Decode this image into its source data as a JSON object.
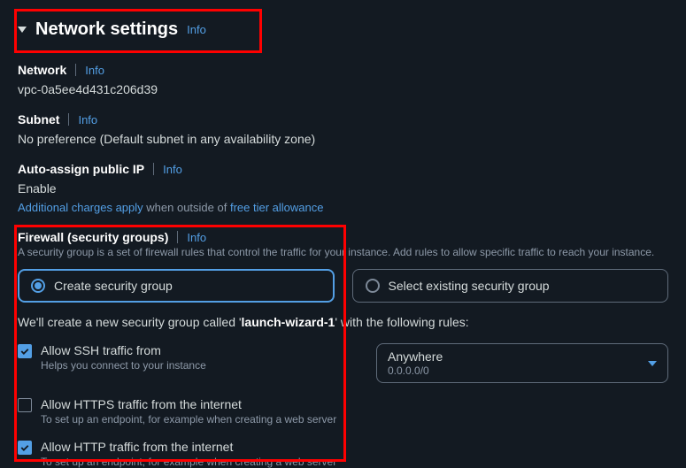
{
  "header": {
    "title": "Network settings",
    "info": "Info"
  },
  "network": {
    "label": "Network",
    "info": "Info",
    "value": "vpc-0a5ee4d431c206d39"
  },
  "subnet": {
    "label": "Subnet",
    "info": "Info",
    "value": "No preference (Default subnet in any availability zone)"
  },
  "publicIp": {
    "label": "Auto-assign public IP",
    "info": "Info",
    "value": "Enable",
    "charges_prefix": "Additional charges apply",
    "charges_mid": " when outside of ",
    "charges_link": "free tier allowance"
  },
  "firewall": {
    "label": "Firewall (security groups)",
    "info": "Info",
    "desc": "A security group is a set of firewall rules that control the traffic for your instance. Add rules to allow specific traffic to reach your instance.",
    "option_create": "Create security group",
    "option_select": "Select existing security group",
    "sg_note_pre": "We'll create a new security group called '",
    "sg_name": "launch-wizard-1",
    "sg_note_post": "' with the following rules:"
  },
  "rules": {
    "ssh": {
      "title": "Allow SSH traffic from",
      "desc": "Helps you connect to your instance"
    },
    "https": {
      "title": "Allow HTTPS traffic from the internet",
      "desc": "To set up an endpoint, for example when creating a web server"
    },
    "http": {
      "title": "Allow HTTP traffic from the internet",
      "desc": "To set up an endpoint, for example when creating a web server"
    }
  },
  "ssh_source": {
    "label": "Anywhere",
    "value": "0.0.0.0/0"
  }
}
